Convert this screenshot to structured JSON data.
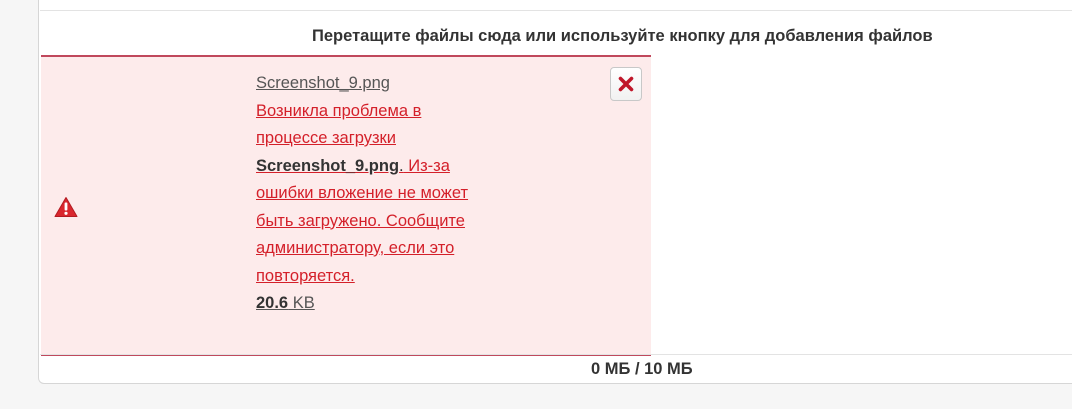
{
  "upload": {
    "hint": "Перетащите файлы сюда или используйте кнопку для добавления файлов",
    "quota": "0 МБ / 10 МБ"
  },
  "file": {
    "name": "Screenshot_9.png",
    "error_prefix": "Возникла проблема в процессе загрузки ",
    "error_file": "Screenshot_9.png",
    "error_sep": ".",
    "error_suffix": " Из-за ошибки вложение не может быть загружено. Сообщите администратору, если это повторяется.",
    "size_value": "20.6",
    "size_unit": " KB",
    "status_icon": "error-warning-icon",
    "remove_icon": "close-icon"
  },
  "colors": {
    "error_bg": "#fdebeb",
    "error_border": "#c0485c",
    "error_text": "#d4202a",
    "remove_x": "#c0172a"
  }
}
